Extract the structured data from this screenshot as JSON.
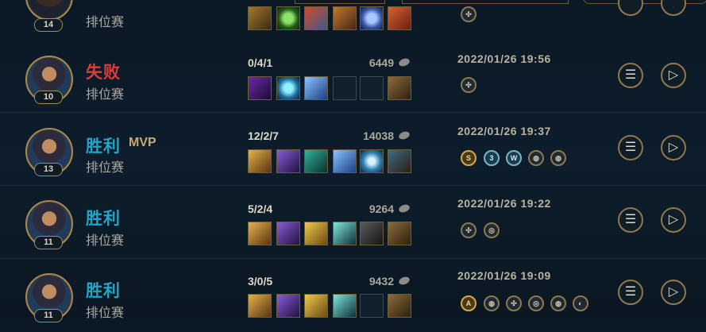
{
  "top_partial": {
    "level": "14",
    "mode": "排位赛"
  },
  "matches": [
    {
      "result": "失败",
      "result_type": "lose",
      "mvp": "",
      "mode": "排位赛",
      "level": "10",
      "kda": "0/4/1",
      "gold": "6449",
      "date": "2022/01/26 19:56",
      "items": [
        "purple-blade-icon",
        "blue-orb-icon",
        "blue-sword-icon",
        "",
        "",
        "boots-icon"
      ],
      "badges": [
        {
          "label": "✣",
          "style": "plain"
        }
      ]
    },
    {
      "result": "胜利",
      "result_type": "win",
      "mvp": "MVP",
      "mode": "排位赛",
      "level": "13",
      "kda": "12/2/7",
      "gold": "14038",
      "date": "2022/01/26 19:37",
      "items": [
        "gold-spear-icon",
        "purple-cross-blade-icon",
        "teal-claw-icon",
        "blue-sword-icon",
        "blue-shield-orb-icon",
        "boots-icon"
      ],
      "badges": [
        {
          "label": "S",
          "style": "gold"
        },
        {
          "label": "3",
          "style": "blue"
        },
        {
          "label": "W",
          "style": "blue"
        },
        {
          "label": "◍",
          "style": "plain"
        },
        {
          "label": "◍",
          "style": "plain"
        }
      ]
    },
    {
      "result": "胜利",
      "result_type": "win",
      "mvp": "",
      "mode": "排位赛",
      "level": "11",
      "kda": "5/2/4",
      "gold": "9264",
      "date": "2022/01/26 19:22",
      "items": [
        "gold-spear-icon",
        "purple-cross-blade-icon",
        "gold-cross-icon",
        "teal-blade-icon",
        "dark-armor-icon",
        "boots-icon"
      ],
      "badges": [
        {
          "label": "✣",
          "style": "plain"
        },
        {
          "label": "◎",
          "style": "plain"
        }
      ]
    },
    {
      "result": "胜利",
      "result_type": "win",
      "mvp": "",
      "mode": "排位赛",
      "level": "11",
      "kda": "3/0/5",
      "gold": "9432",
      "date": "2022/01/26 19:09",
      "items": [
        "gold-spear-icon",
        "purple-cross-blade-icon",
        "gold-cross-icon",
        "teal-blade-icon",
        "",
        "boots-icon"
      ],
      "badges": [
        {
          "label": "A",
          "style": "gold"
        },
        {
          "label": "◍",
          "style": "plain"
        },
        {
          "label": "✣",
          "style": "plain"
        },
        {
          "label": "◎",
          "style": "plain"
        },
        {
          "label": "◍",
          "style": "plain"
        },
        {
          "label": "◐",
          "style": "plain"
        }
      ]
    }
  ],
  "buttons": {
    "details_icon": "list-icon",
    "replay_icon": "replay-icon"
  },
  "colors": {
    "lose": "#e03a3a",
    "win": "#1da7c9",
    "gold_accent": "#c8aa6e"
  }
}
